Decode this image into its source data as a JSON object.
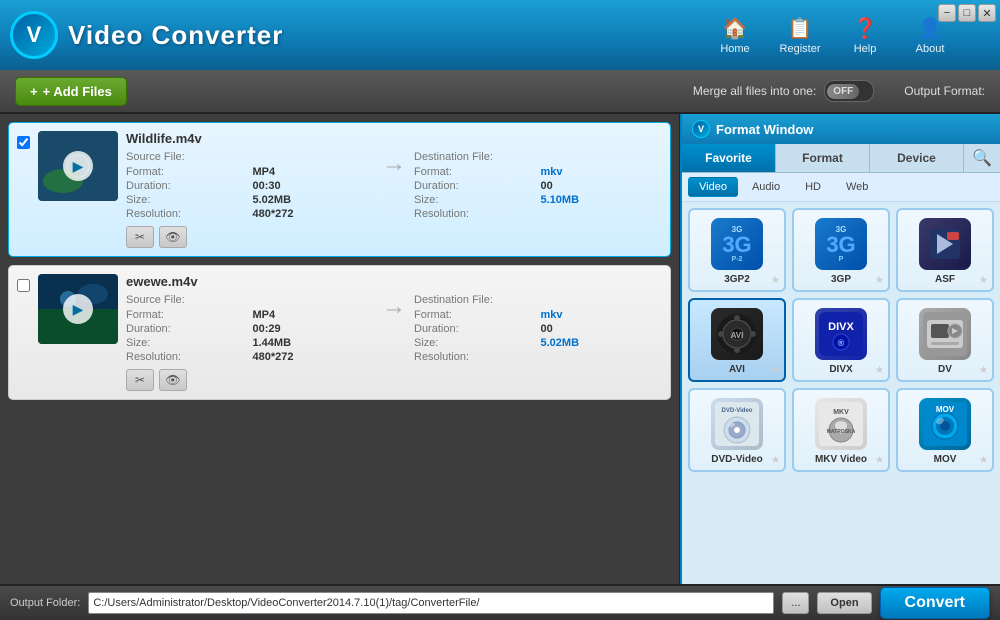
{
  "app": {
    "logo_text": "V",
    "title": "Video Converter",
    "nav": [
      {
        "id": "home",
        "label": "Home",
        "icon": "🏠"
      },
      {
        "id": "register",
        "label": "Register",
        "icon": "📋"
      },
      {
        "id": "help",
        "label": "Help",
        "icon": "❓"
      },
      {
        "id": "about",
        "label": "About",
        "icon": "👤"
      }
    ],
    "win_controls": [
      {
        "id": "minimize",
        "symbol": "−"
      },
      {
        "id": "restore",
        "symbol": "□"
      },
      {
        "id": "close",
        "symbol": "✕"
      }
    ]
  },
  "toolbar": {
    "add_files_label": "+ Add Files",
    "merge_label": "Merge all files into one:",
    "merge_state": "OFF",
    "output_format_label": "Output Format:"
  },
  "files": [
    {
      "id": "file1",
      "selected": true,
      "name": "Wildlife.m4v",
      "source_label": "Source File:",
      "format_label": "Format:",
      "format_value": "MP4",
      "duration_label": "Duration:",
      "duration_value": "00:30",
      "size_label": "Size:",
      "size_value": "5.02MB",
      "resolution_label": "Resolution:",
      "resolution_value": "480*272",
      "dest_label": "Destination File:",
      "dest_format_label": "Format:",
      "dest_format_value": "mkv",
      "dest_duration_label": "Duration:",
      "dest_duration_value": "00",
      "dest_size_label": "Size:",
      "dest_size_value": "5.10MB",
      "dest_resolution_label": "Resolution:",
      "dest_resolution_value": ""
    },
    {
      "id": "file2",
      "selected": false,
      "name": "ewewe.m4v",
      "source_label": "Source File:",
      "format_label": "Format:",
      "format_value": "MP4",
      "duration_label": "Duration:",
      "duration_value": "00:29",
      "size_label": "Size:",
      "size_value": "1.44MB",
      "resolution_label": "Resolution:",
      "resolution_value": "480*272",
      "dest_label": "Destination File:",
      "dest_format_label": "Format:",
      "dest_format_value": "mkv",
      "dest_duration_label": "Duration:",
      "dest_duration_value": "00",
      "dest_size_label": "Size:",
      "dest_size_value": "5.02MB",
      "dest_resolution_label": "Resolution:",
      "dest_resolution_value": ""
    }
  ],
  "format_window": {
    "title": "Format Window",
    "tabs": [
      {
        "id": "favorite",
        "label": "Favorite"
      },
      {
        "id": "format",
        "label": "Format"
      },
      {
        "id": "device",
        "label": "Device"
      }
    ],
    "active_tab": "Favorite",
    "filter_tabs": [
      {
        "id": "video",
        "label": "Video"
      },
      {
        "id": "audio",
        "label": "Audio"
      },
      {
        "id": "hd",
        "label": "HD"
      },
      {
        "id": "web",
        "label": "Web"
      }
    ],
    "active_filter": "Video",
    "formats": [
      [
        {
          "id": "3gp2",
          "label": "3GP2",
          "type": "3g2"
        },
        {
          "id": "3gp",
          "label": "3GP",
          "type": "3g"
        },
        {
          "id": "asf",
          "label": "ASF",
          "type": "asf"
        }
      ],
      [
        {
          "id": "avi",
          "label": "AVI",
          "type": "avi"
        },
        {
          "id": "divx",
          "label": "DIVX",
          "type": "divx"
        },
        {
          "id": "dv",
          "label": "DV",
          "type": "dv"
        }
      ],
      [
        {
          "id": "dvd-video",
          "label": "DVD-Video",
          "type": "dvd"
        },
        {
          "id": "mkv-video",
          "label": "MKV Video",
          "type": "mkv"
        },
        {
          "id": "mov",
          "label": "MOV",
          "type": "mov"
        }
      ]
    ]
  },
  "bottom": {
    "output_folder_label": "Output Folder:",
    "output_folder_value": "C:/Users/Administrator/Desktop/VideoConverter2014.7.10(1)/tag/ConverterFile/",
    "browse_label": "...",
    "open_label": "Open",
    "convert_label": "Convert"
  }
}
